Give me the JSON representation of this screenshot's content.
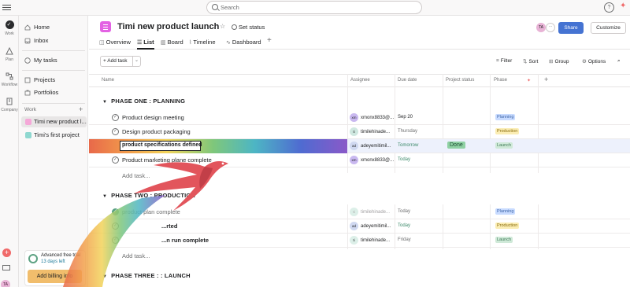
{
  "search": {
    "placeholder": "Search"
  },
  "help_label": "?",
  "rail": {
    "items": [
      {
        "label": "Work"
      },
      {
        "label": "Plan"
      },
      {
        "label": "Workflow"
      },
      {
        "label": "Company"
      }
    ],
    "avatar": "TA"
  },
  "sidebar": {
    "nav": [
      {
        "label": "Home",
        "icon": "home-icon"
      },
      {
        "label": "Inbox",
        "icon": "inbox-icon"
      },
      {
        "label": "My tasks",
        "icon": "check-circle-icon"
      },
      {
        "label": "Projects",
        "icon": "projects-icon"
      },
      {
        "label": "Portfolios",
        "icon": "portfolio-icon"
      }
    ],
    "work_label": "Work",
    "projects": [
      {
        "label": "Timi new product l...",
        "color": "#f5a8d8"
      },
      {
        "label": "Timi's first project",
        "color": "#8fd8d0"
      }
    ],
    "trial": {
      "title": "Advanced free trial",
      "days": "13 days left",
      "button": "Add billing info"
    }
  },
  "header": {
    "title": "Timi new product launch",
    "set_status": "Set status",
    "avatar": "TA",
    "share": "Share",
    "customize": "Customize"
  },
  "tabs": [
    {
      "label": "Overview"
    },
    {
      "label": "List"
    },
    {
      "label": "Board"
    },
    {
      "label": "Timeline"
    },
    {
      "label": "Dashboard"
    }
  ],
  "toolbar": {
    "add_task": "Add task",
    "filter": "Filter",
    "sort": "Sort",
    "group": "Group",
    "options": "Options"
  },
  "columns": {
    "name": "Name",
    "assignee": "Assignee",
    "due_date": "Due date",
    "project_status": "Project status",
    "phase": "Phase"
  },
  "sections": [
    {
      "title": "PHASE ONE : PLANNING"
    },
    {
      "title": "PHASE TWO : PRODUCTION"
    },
    {
      "title": "PHASE THREE : : LAUNCH"
    }
  ],
  "rows": [
    {
      "task": "Product design meeting",
      "initials": "xm",
      "assignee": "xmonx8833@...",
      "due": "Sep 20",
      "phase": "Planning"
    },
    {
      "task": "Design product packaging",
      "initials": "ti",
      "assignee": "timilehinade...",
      "due": "Thursday",
      "phase": "Production"
    },
    {
      "task": "product specifications defined",
      "initials": "ad",
      "assignee": "adeyemitimil...",
      "due": "Tomorrow",
      "status": "Done",
      "phase": "Launch"
    },
    {
      "task": "Product marketing plane complete",
      "initials": "xm",
      "assignee": "xmonx8833@...",
      "due": "Today",
      "phase": ""
    },
    {
      "task": "product plan complete",
      "initials": "ti",
      "assignee": "timilehinade...",
      "due": "Today",
      "phase": "Planning"
    },
    {
      "task": "...rted",
      "initials": "ad",
      "assignee": "adeyemitimil...",
      "due": "Today",
      "phase": "Production"
    },
    {
      "task": "...n run complete",
      "initials": "ti",
      "assignee": "timilehinade...",
      "due": "Friday",
      "phase": "Launch"
    }
  ],
  "add_task_link": "Add task..."
}
